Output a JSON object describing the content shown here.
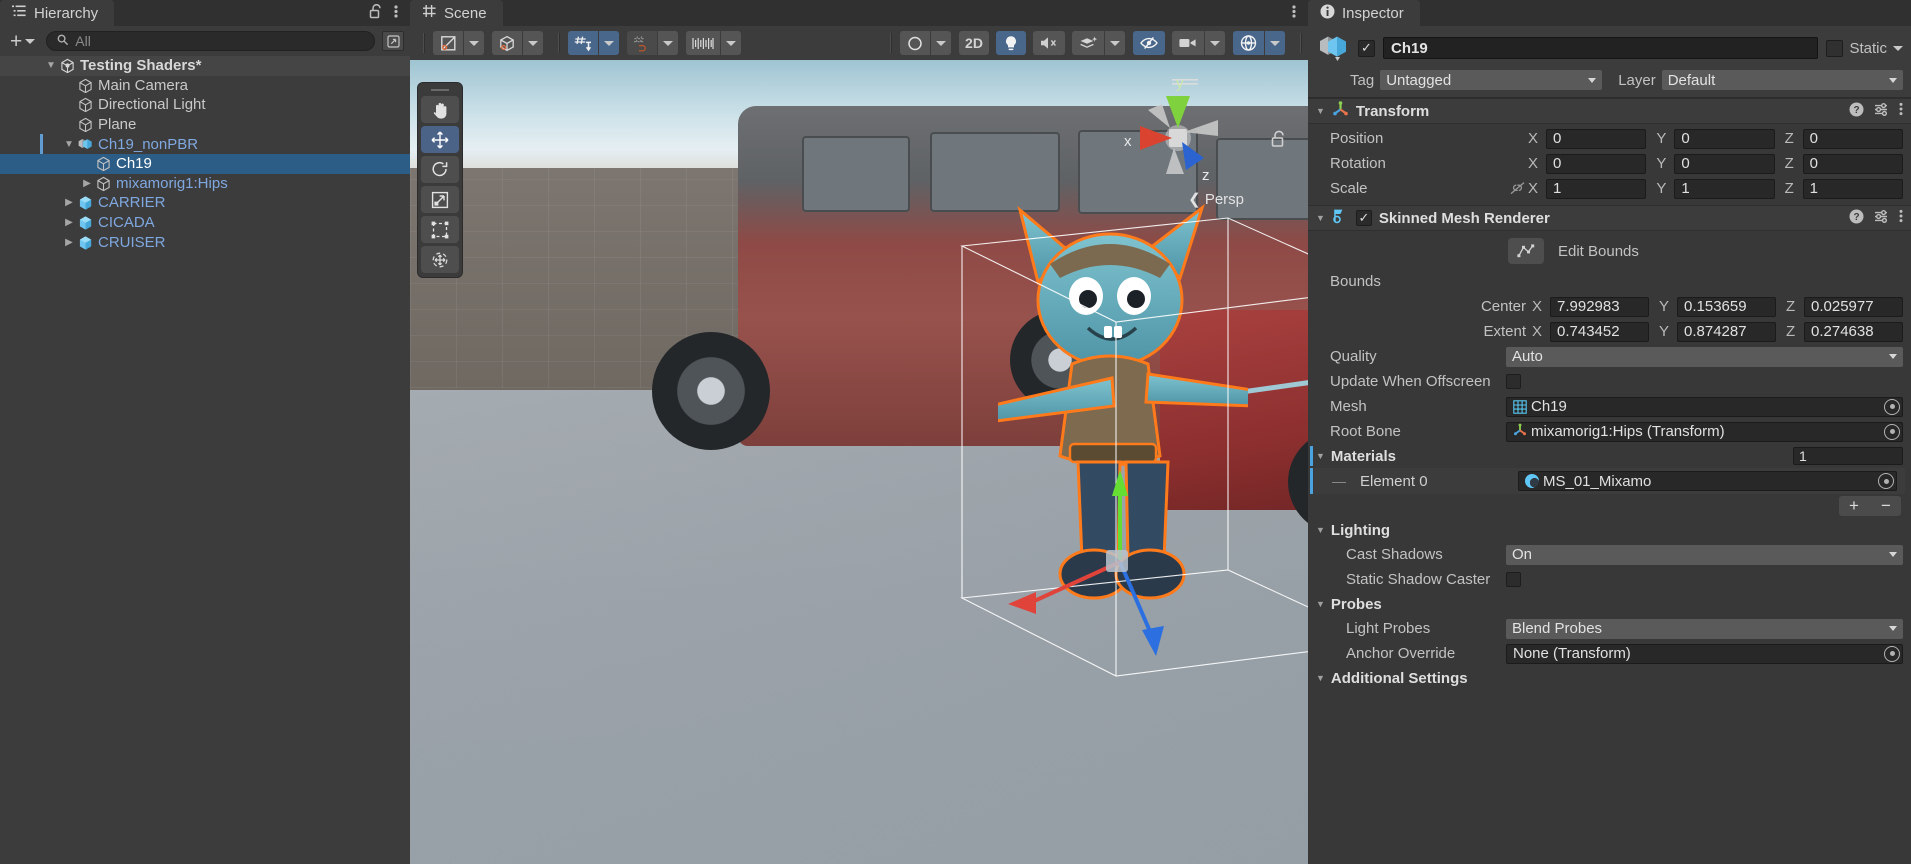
{
  "hierarchy": {
    "tab_label": "Hierarchy",
    "tab_icon": "hierarchy-list-icon",
    "lock_icon": "lock-open-icon",
    "menu_icon": "kebab-menu-icon",
    "add_label": "+",
    "search": {
      "value": "",
      "placeholder": "All"
    },
    "items": [
      {
        "label": "Testing Shaders*",
        "depth": 0,
        "fold": "open",
        "icon": "unity-scene-icon",
        "style": "bold",
        "selected": false,
        "root": true
      },
      {
        "label": "Main Camera",
        "depth": 1,
        "fold": "none",
        "icon": "gameobject-icon",
        "style": "plain",
        "selected": false
      },
      {
        "label": "Directional Light",
        "depth": 1,
        "fold": "none",
        "icon": "gameobject-icon",
        "style": "plain",
        "selected": false
      },
      {
        "label": "Plane",
        "depth": 1,
        "fold": "none",
        "icon": "gameobject-icon",
        "style": "plain",
        "selected": false
      },
      {
        "label": "Ch19_nonPBR",
        "depth": 1,
        "fold": "open",
        "icon": "prefab-variant-icon",
        "style": "prefab",
        "selected": false
      },
      {
        "label": "Ch19",
        "depth": 2,
        "fold": "none",
        "icon": "gameobject-icon",
        "style": "white",
        "selected": true
      },
      {
        "label": "mixamorig1:Hips",
        "depth": 2,
        "fold": "closed",
        "icon": "gameobject-icon",
        "style": "prefab",
        "selected": false
      },
      {
        "label": "CARRIER",
        "depth": 1,
        "fold": "closed",
        "icon": "prefab-icon",
        "style": "prefab",
        "selected": false
      },
      {
        "label": "CICADA",
        "depth": 1,
        "fold": "closed",
        "icon": "prefab-icon",
        "style": "prefab",
        "selected": false
      },
      {
        "label": "CRUISER",
        "depth": 1,
        "fold": "closed",
        "icon": "prefab-icon",
        "style": "prefab",
        "selected": false
      }
    ]
  },
  "scene": {
    "tab_label": "Scene",
    "tab_icon": "scene-grid-icon",
    "menu_icon": "kebab-menu-icon",
    "toolbar": [
      {
        "name": "draw-mode-shaded-icon",
        "type": "button",
        "active": false,
        "label": ""
      },
      {
        "name": "draw-mode-dropdown",
        "type": "dropdown",
        "active": false,
        "label": ""
      },
      {
        "name": "shading-mode-icon",
        "type": "button",
        "active": false,
        "label": ""
      },
      {
        "name": "shading-mode-dropdown",
        "type": "dropdown",
        "active": false,
        "label": ""
      },
      {
        "name": "grid-visibility-icon",
        "type": "button",
        "active": true,
        "label": ""
      },
      {
        "name": "grid-visibility-dropdown",
        "type": "dropdown",
        "active": true,
        "label": ""
      },
      {
        "name": "grid-snap-icon",
        "type": "button",
        "active": false,
        "label": ""
      },
      {
        "name": "grid-snap-dropdown",
        "type": "dropdown",
        "active": false,
        "label": ""
      },
      {
        "name": "increment-snap-icon",
        "type": "button",
        "active": false,
        "label": ""
      },
      {
        "name": "increment-snap-dropdown",
        "type": "dropdown",
        "active": false,
        "label": ""
      },
      {
        "name": "scene-view-camera-icon",
        "type": "button",
        "active": false,
        "label": ""
      },
      {
        "name": "scene-view-camera-dropdown",
        "type": "dropdown",
        "active": false,
        "label": ""
      },
      {
        "name": "toggle-2d-button",
        "type": "button",
        "active": false,
        "label": "2D"
      },
      {
        "name": "scene-lighting-icon",
        "type": "button",
        "active": true,
        "label": ""
      },
      {
        "name": "scene-audio-icon",
        "type": "button",
        "active": false,
        "label": ""
      },
      {
        "name": "scene-fx-icon",
        "type": "button",
        "active": false,
        "label": ""
      },
      {
        "name": "scene-fx-dropdown",
        "type": "dropdown",
        "active": false,
        "label": ""
      },
      {
        "name": "hidden-objects-icon",
        "type": "button",
        "active": true,
        "label": ""
      },
      {
        "name": "camera-overlay-icon",
        "type": "button",
        "active": false,
        "label": ""
      },
      {
        "name": "camera-overlay-dropdown",
        "type": "dropdown",
        "active": false,
        "label": ""
      },
      {
        "name": "gizmos-toggle-icon",
        "type": "button",
        "active": true,
        "label": ""
      },
      {
        "name": "gizmos-dropdown",
        "type": "dropdown",
        "active": true,
        "label": ""
      }
    ],
    "tools": [
      {
        "name": "hand-tool",
        "active": false
      },
      {
        "name": "move-tool",
        "active": true
      },
      {
        "name": "rotate-tool",
        "active": false
      },
      {
        "name": "scale-tool",
        "active": false
      },
      {
        "name": "rect-tool",
        "active": false
      },
      {
        "name": "transform-tool",
        "active": false
      }
    ],
    "gizmo": {
      "x_label": "x",
      "y_label": "y",
      "z_label": "z",
      "persp_label": "Persp",
      "persp_arrow": "❮"
    }
  },
  "inspector": {
    "tab_label": "Inspector",
    "tab_icon": "info-icon",
    "object": {
      "icon": "prefab-variant-icon",
      "enabled": true,
      "name": "Ch19",
      "static_label": "Static",
      "static_checked": false,
      "tag_label": "Tag",
      "tag_value": "Untagged",
      "layer_label": "Layer",
      "layer_value": "Default"
    },
    "transform": {
      "title": "Transform",
      "icon": "transform-axis-icon",
      "help_icon": "help-icon",
      "preset_icon": "preset-icon",
      "menu_icon": "kebab-menu-icon",
      "rows": [
        {
          "label": "Position",
          "x": "0",
          "y": "0",
          "z": "0",
          "lock": false
        },
        {
          "label": "Rotation",
          "x": "0",
          "y": "0",
          "z": "0",
          "lock": false
        },
        {
          "label": "Scale",
          "x": "1",
          "y": "1",
          "z": "1",
          "lock": true
        }
      ],
      "axis_labels": [
        "X",
        "Y",
        "Z"
      ]
    },
    "skinned_mesh_renderer": {
      "title": "Skinned Mesh Renderer",
      "icon": "skinned-mesh-renderer-icon",
      "enabled": true,
      "help_icon": "help-icon",
      "preset_icon": "preset-icon",
      "menu_icon": "kebab-menu-icon",
      "edit_bounds_label": "Edit Bounds",
      "edit_bounds_icon": "edit-bounds-icon",
      "bounds_label": "Bounds",
      "center_label": "Center",
      "center": {
        "x": "7.992983",
        "y": "0.153659",
        "z": "0.025977"
      },
      "extent_label": "Extent",
      "extent": {
        "x": "0.743452",
        "y": "0.874287",
        "z": "0.274638"
      },
      "quality_label": "Quality",
      "quality_value": "Auto",
      "update_offscreen_label": "Update When Offscreen",
      "update_offscreen_checked": false,
      "mesh_label": "Mesh",
      "mesh_value": "Ch19",
      "mesh_icon": "mesh-icon",
      "root_bone_label": "Root Bone",
      "root_bone_value": "mixamorig1:Hips (Transform)",
      "root_bone_icon": "transform-axis-icon",
      "materials_label": "Materials",
      "materials_count": "1",
      "material_elements": [
        {
          "label": "Element 0",
          "value": "MS_01_Mixamo",
          "icon": "material-sphere-icon"
        }
      ],
      "add_label": "+",
      "remove_label": "−",
      "lighting_label": "Lighting",
      "cast_shadows_label": "Cast Shadows",
      "cast_shadows_value": "On",
      "static_shadow_caster_label": "Static Shadow Caster",
      "static_shadow_caster_checked": false,
      "probes_label": "Probes",
      "light_probes_label": "Light Probes",
      "light_probes_value": "Blend Probes",
      "anchor_override_label": "Anchor Override",
      "anchor_override_value": "None (Transform)",
      "additional_settings_label": "Additional Settings"
    }
  },
  "colors": {
    "selection_blue": "#2c5d87",
    "prefab_blue": "#7fa8e0",
    "accent_cyan": "#4aa3df",
    "toolbar_active": "#49678b",
    "outline_orange": "#ff7a1a"
  }
}
